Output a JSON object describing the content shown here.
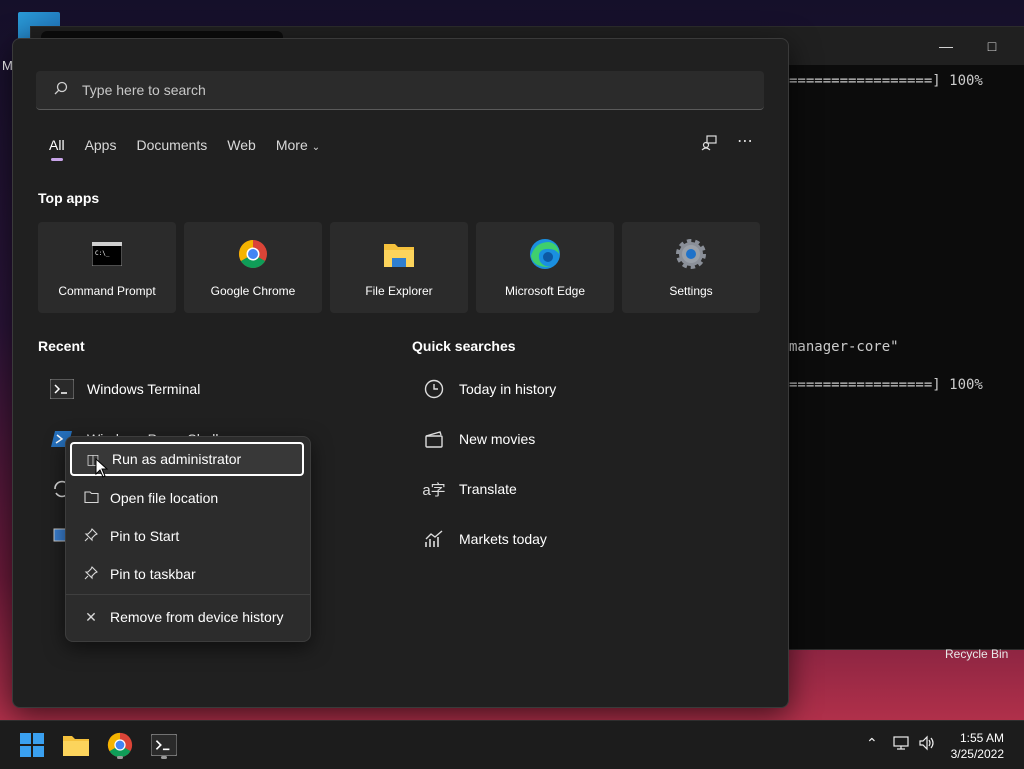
{
  "desktop": {
    "corner_letter": "M",
    "recycle_bin": "Recycle Bin"
  },
  "terminal": {
    "lines": [
      "=================] 100%",
      "manager-core\"",
      "=================] 100%"
    ]
  },
  "search": {
    "placeholder": "Type here to search"
  },
  "tabs": [
    {
      "label": "All"
    },
    {
      "label": "Apps"
    },
    {
      "label": "Documents"
    },
    {
      "label": "Web"
    },
    {
      "label": "More"
    }
  ],
  "top_apps": {
    "heading": "Top apps",
    "items": [
      {
        "label": "Command Prompt",
        "icon": "cmd-icon"
      },
      {
        "label": "Google Chrome",
        "icon": "chrome-icon"
      },
      {
        "label": "File Explorer",
        "icon": "folder-icon"
      },
      {
        "label": "Microsoft Edge",
        "icon": "edge-icon"
      },
      {
        "label": "Settings",
        "icon": "gear-icon"
      }
    ]
  },
  "recent": {
    "heading": "Recent",
    "items": [
      {
        "label": "Windows Terminal",
        "icon": "terminal-icon"
      },
      {
        "label": "Windows PowerShell",
        "icon": "powershell-icon"
      }
    ]
  },
  "quick_searches": {
    "heading": "Quick searches",
    "items": [
      {
        "label": "Today in history",
        "icon": "clock-icon"
      },
      {
        "label": "New movies",
        "icon": "clapper-icon"
      },
      {
        "label": "Translate",
        "icon": "translate-icon"
      },
      {
        "label": "Markets today",
        "icon": "chart-icon"
      }
    ]
  },
  "context_menu": {
    "items": [
      {
        "label": "Run as administrator",
        "icon": "shield-icon"
      },
      {
        "label": "Open file location",
        "icon": "folder-outline-icon"
      },
      {
        "label": "Pin to Start",
        "icon": "pin-icon"
      },
      {
        "label": "Pin to taskbar",
        "icon": "pin-icon"
      },
      {
        "label": "Remove from device history",
        "icon": "close-icon"
      }
    ]
  },
  "taskbar": {
    "time": "1:55 AM",
    "date": "3/25/2022"
  },
  "colors": {
    "accent": "#c8a4e8",
    "panel_bg": "#202020"
  }
}
